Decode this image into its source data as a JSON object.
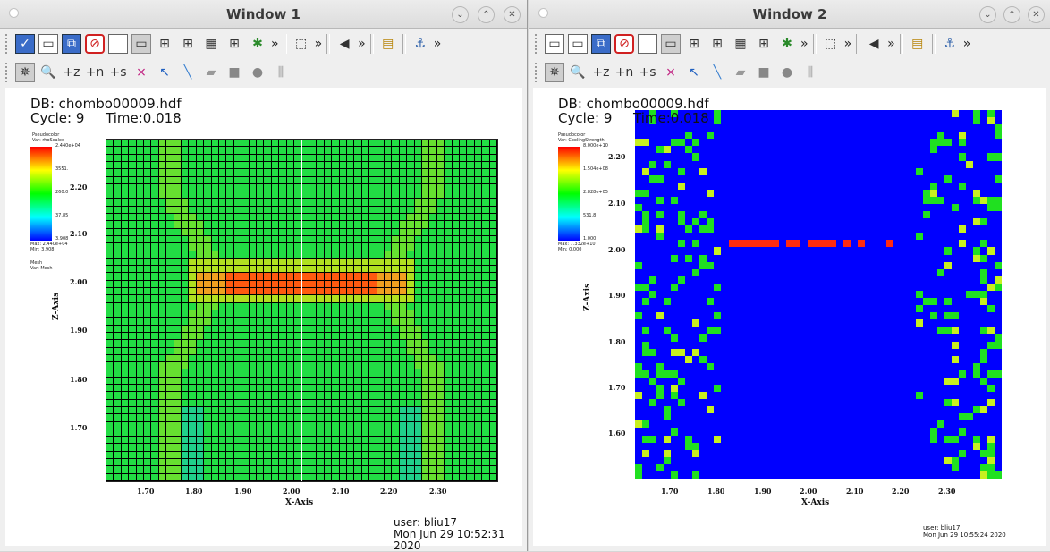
{
  "windows": [
    {
      "title": "Window 1",
      "db_line": "DB: chombo00009.hdf",
      "cycle_line": "Cycle: 9",
      "time_line": "Time:0.018",
      "legend": {
        "plot_type": "Pseudocolor",
        "var": "Var: rhoScaled",
        "ticks": [
          "2.440e+04",
          "3551.",
          "260.0",
          "37.85",
          "3.908"
        ],
        "max": "Max:  2.440e+04",
        "min": "Min:  3.908",
        "mesh_title": "Mesh",
        "mesh_var": "Var: Mesh"
      },
      "y_axis_title": "Z-Axis",
      "x_axis_title": "X-Axis",
      "y_ticks": [
        "2.20",
        "2.10",
        "2.00",
        "1.90",
        "1.80",
        "1.70"
      ],
      "x_ticks": [
        "1.70",
        "1.80",
        "1.90",
        "2.00",
        "2.10",
        "2.20",
        "2.30"
      ],
      "user": "user: bliu17",
      "date": "Mon Jun 29 10:52:31 2020"
    },
    {
      "title": "Window 2",
      "db_line": "DB: chombo00009.hdf",
      "cycle_line": "Cycle: 9",
      "time_line": "Time:0.018",
      "legend": {
        "plot_type": "Pseudocolor",
        "var": "Var: CoolingStrength",
        "ticks": [
          "8.000e+10",
          "1.504e+08",
          "2.828e+05",
          "531.8",
          "1.000"
        ],
        "max": "Max:  7.332e+10",
        "min": "Min:  0.000"
      },
      "y_axis_title": "Z-Axis",
      "x_axis_title": "X-Axis",
      "y_ticks": [
        "2.20",
        "2.10",
        "2.00",
        "1.90",
        "1.80",
        "1.70",
        "1.60"
      ],
      "x_ticks": [
        "1.70",
        "1.80",
        "1.90",
        "2.00",
        "2.10",
        "2.20",
        "2.30"
      ],
      "user": "user: bliu17",
      "date": "Mon Jun 29 10:55:24 2020"
    }
  ],
  "toolbar_overflow": "»",
  "window_buttons": {
    "minimize": "⌄",
    "maximize": "⌃",
    "close": "✕"
  }
}
